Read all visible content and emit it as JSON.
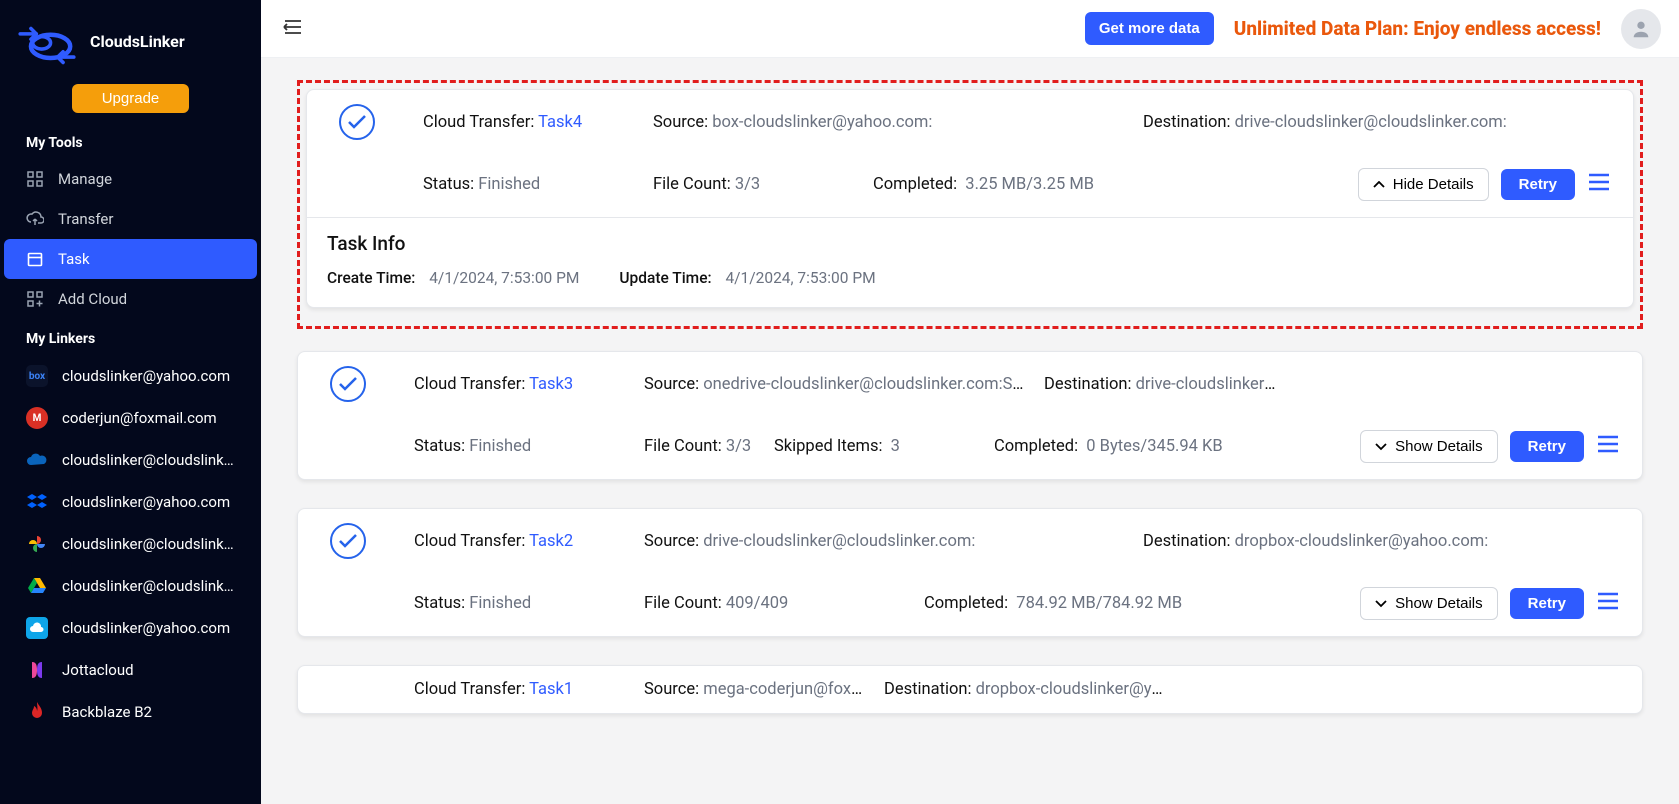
{
  "brand": {
    "name": "CloudsLinker"
  },
  "upgrade_label": "Upgrade",
  "section_tools": "My Tools",
  "section_linkers": "My Linkers",
  "nav": {
    "manage": "Manage",
    "transfer": "Transfer",
    "task": "Task",
    "add_cloud": "Add Cloud"
  },
  "linkers": [
    {
      "icon": "box",
      "label": "cloudslinker@yahoo.com"
    },
    {
      "icon": "mega",
      "label": "coderjun@foxmail.com"
    },
    {
      "icon": "onedrive",
      "label": "cloudslinker@cloudslinker.co..."
    },
    {
      "icon": "dropbox",
      "label": "cloudslinker@yahoo.com"
    },
    {
      "icon": "gphotos",
      "label": "cloudslinker@cloudslinker.co..."
    },
    {
      "icon": "gdrive",
      "label": "cloudslinker@cloudslinker.co..."
    },
    {
      "icon": "pcloud",
      "label": "cloudslinker@yahoo.com"
    },
    {
      "icon": "jotta",
      "label": "Jottacloud"
    },
    {
      "icon": "backblaze",
      "label": "Backblaze B2"
    }
  ],
  "topbar": {
    "get_more_data": "Get more data",
    "unlimited": "Unlimited Data Plan: Enjoy endless access!"
  },
  "labels": {
    "cloud_transfer": "Cloud Transfer: ",
    "source": "Source: ",
    "destination": "Destination: ",
    "status": "Status: ",
    "file_count": "File Count: ",
    "skipped_items": "Skipped Items:",
    "completed": "Completed:",
    "hide_details": "Hide Details",
    "show_details": "Show Details",
    "retry": "Retry",
    "task_info": "Task Info",
    "create_time": "Create Time:",
    "update_time": "Update Time:"
  },
  "tasks": [
    {
      "name": "Task4",
      "source": "box-cloudslinker@yahoo.com:",
      "destination": "drive-cloudslinker@cloudslinker.com:",
      "status": "Finished",
      "file_count": "3/3",
      "completed": "3.25 MB/3.25 MB",
      "expanded": true,
      "info": {
        "create_time": "4/1/2024, 7:53:00 PM",
        "update_time": "4/1/2024, 7:53:00 PM"
      }
    },
    {
      "name": "Task3",
      "source": "onedrive-cloudslinker@cloudslinker.com:Screens…",
      "destination": "drive-cloudslinker@clo…",
      "status": "Finished",
      "file_count": "3/3",
      "skipped": "3",
      "completed": "0 Bytes/345.94 KB",
      "expanded": false
    },
    {
      "name": "Task2",
      "source": "drive-cloudslinker@cloudslinker.com:",
      "destination": "dropbox-cloudslinker@yahoo.com:",
      "status": "Finished",
      "file_count": "409/409",
      "completed": "784.92 MB/784.92 MB",
      "expanded": false
    },
    {
      "name": "Task1",
      "source": "mega-coderjun@foxm…",
      "destination": "dropbox-cloudslinker@ya…",
      "expanded": false
    }
  ]
}
